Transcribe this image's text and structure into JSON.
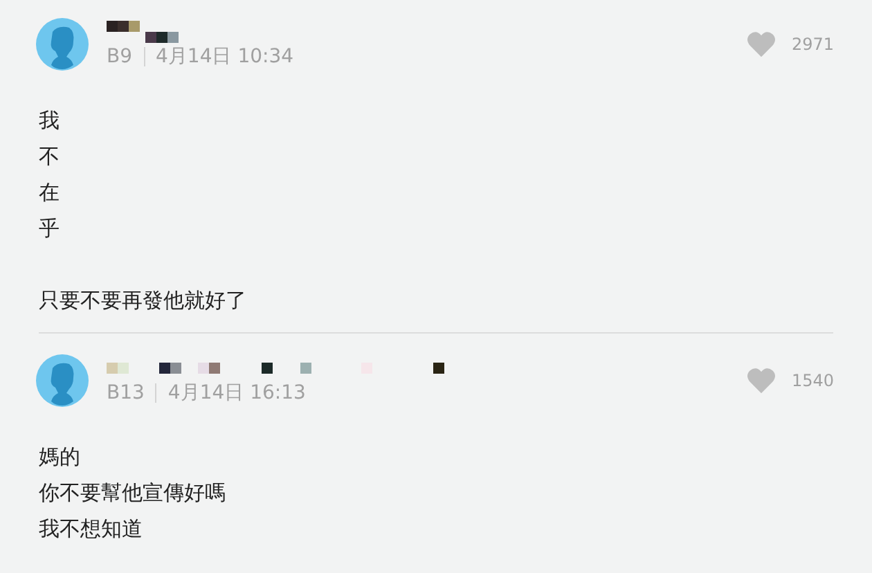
{
  "comments": [
    {
      "floor": "B9",
      "time": "4月14日 10:34",
      "likes": "2971",
      "kind": "short",
      "paragraphs": [
        [
          "我",
          "不",
          "在",
          "乎"
        ],
        [
          "只要不要再發他就好了"
        ]
      ]
    },
    {
      "floor": "B13",
      "time": "4月14日 16:13",
      "likes": "1540",
      "kind": "long",
      "paragraphs": [
        [
          "媽的",
          "你不要幫他宣傳好嗎",
          "我不想知道"
        ]
      ]
    }
  ]
}
